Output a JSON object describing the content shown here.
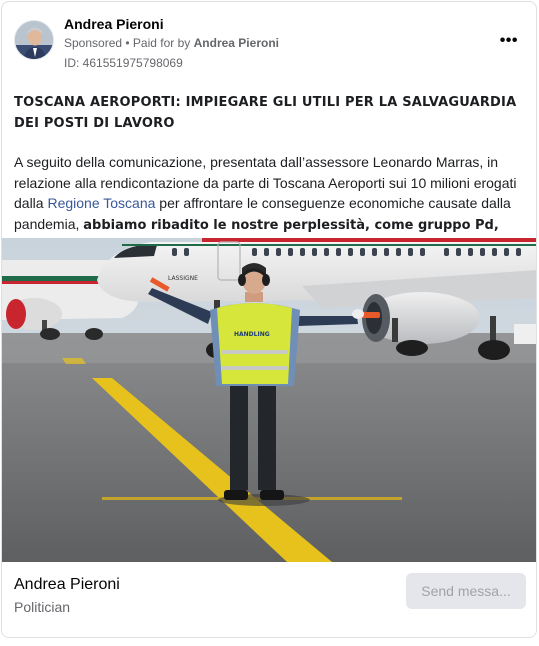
{
  "post": {
    "page_name": "Andrea Pieroni",
    "sponsored_label": "Sponsored",
    "paid_for_prefix": " • Paid for by ",
    "paid_for_name": "Andrea Pieroni",
    "ad_id": "ID: 461551975798069",
    "more_label": "•••",
    "title": "TOSCANA AEROPORTI: IMPIEGARE GLI UTILI PER LA SALVAGUARDIA DEI POSTI DI LAVORO",
    "body_text_1": "A seguito della comunicazione, presentata dall’assessore Leonardo Marras, in relazione alla rendicontazione da parte di Toscana Aeroporti sui 10 milioni erogati dalla ",
    "body_link": "Regione Toscana",
    "body_text_2": " per affrontare le conseguenze economiche causate dalla pandemia, ",
    "body_bold": "abbiamo ribadito le nostre perplessità, come gruppo Pd, sulla…",
    "image_vest_text": "HANDLING",
    "image_plane_text": "LASSIGNE"
  },
  "footer": {
    "page_name": "Andrea Pieroni",
    "category": "Politician",
    "send_button": "Send messa..."
  },
  "colors": {
    "link": "#385898",
    "meta_gray": "#65676b",
    "button_bg": "#e4e6eb",
    "vest": "#d6e63a",
    "marking_yellow": "#e8c21c"
  }
}
